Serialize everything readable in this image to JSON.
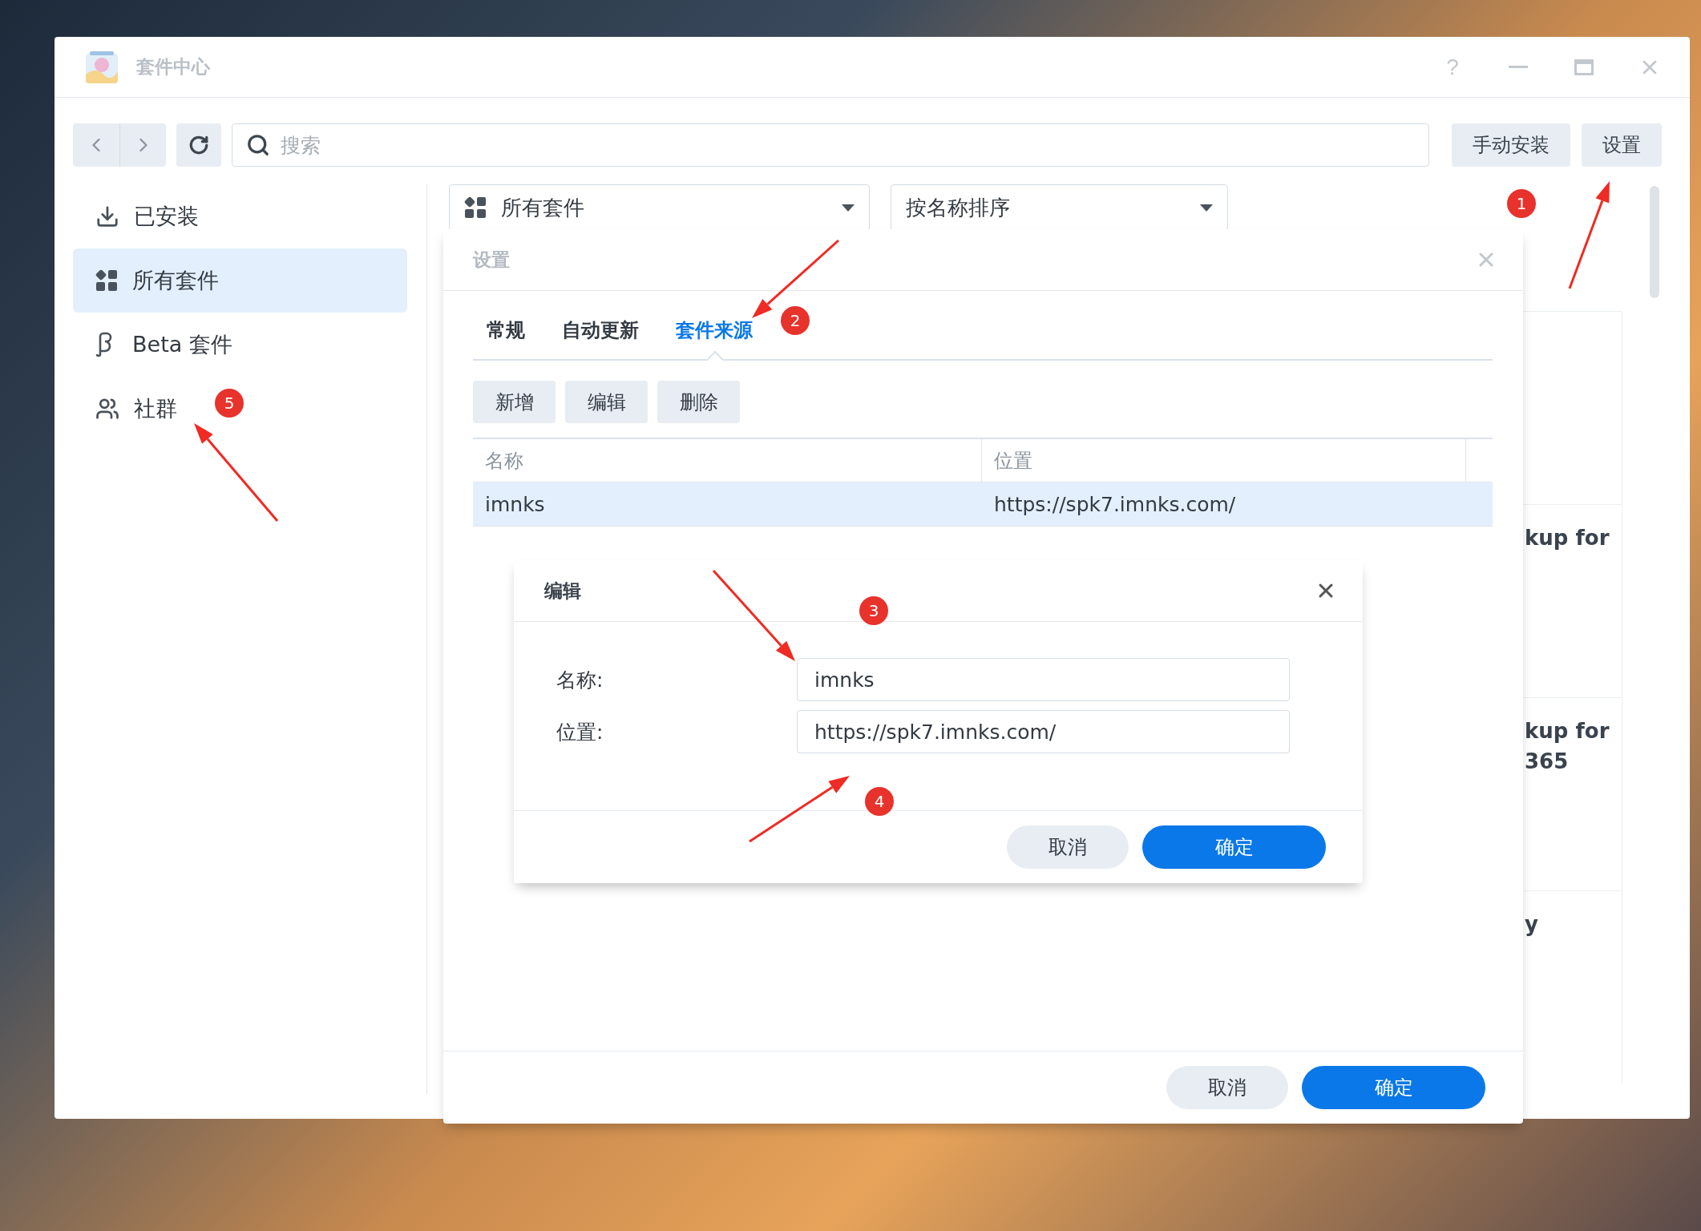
{
  "window": {
    "title": "套件中心",
    "help": "?"
  },
  "toolbar": {
    "search": {
      "placeholder": "搜索"
    },
    "buttons": [
      "手动安装",
      "设置"
    ]
  },
  "sidebar": {
    "items": [
      {
        "label": "已安装",
        "kind": "download",
        "selected": false
      },
      {
        "label": "所有套件",
        "kind": "grid",
        "selected": true
      },
      {
        "label": "Beta 套件",
        "kind": "beta",
        "selected": false
      },
      {
        "label": "社群",
        "kind": "community",
        "selected": false
      }
    ]
  },
  "filters": [
    {
      "label": "所有套件",
      "kind": "category"
    },
    {
      "label": "按名称排序",
      "kind": "sort"
    }
  ],
  "package_cards": [
    {
      "title_lines": [
        "kup for"
      ]
    },
    {
      "title_lines": [
        "kup for",
        "365"
      ]
    },
    {
      "title_lines": [
        "y"
      ]
    }
  ],
  "settings_dialog": {
    "title": "设置",
    "tabs": [
      {
        "label": "常规",
        "selected": false
      },
      {
        "label": "自动更新",
        "selected": false
      },
      {
        "label": "套件来源",
        "selected": true
      }
    ],
    "actions": [
      "新增",
      "编辑",
      "删除"
    ],
    "table": {
      "columns": [
        "名称",
        "位置"
      ],
      "rows": [
        {
          "cells": [
            "imnks",
            "https://spk7.imnks.com/"
          ],
          "selected": true
        }
      ]
    },
    "buttons": [
      {
        "label": "取消",
        "kind": "secondary"
      },
      {
        "label": "确定",
        "kind": "primary"
      }
    ]
  },
  "edit_dialog": {
    "title": "编辑",
    "fields": [
      {
        "label": "名称:",
        "value": "imnks"
      },
      {
        "label": "位置:",
        "value": "https://spk7.imnks.com/"
      }
    ],
    "buttons": [
      {
        "label": "取消",
        "kind": "secondary"
      },
      {
        "label": "确定",
        "kind": "primary"
      }
    ]
  },
  "annotations": [
    {
      "label": "1"
    },
    {
      "label": "2"
    },
    {
      "label": "3"
    },
    {
      "label": "4"
    },
    {
      "label": "5"
    }
  ]
}
